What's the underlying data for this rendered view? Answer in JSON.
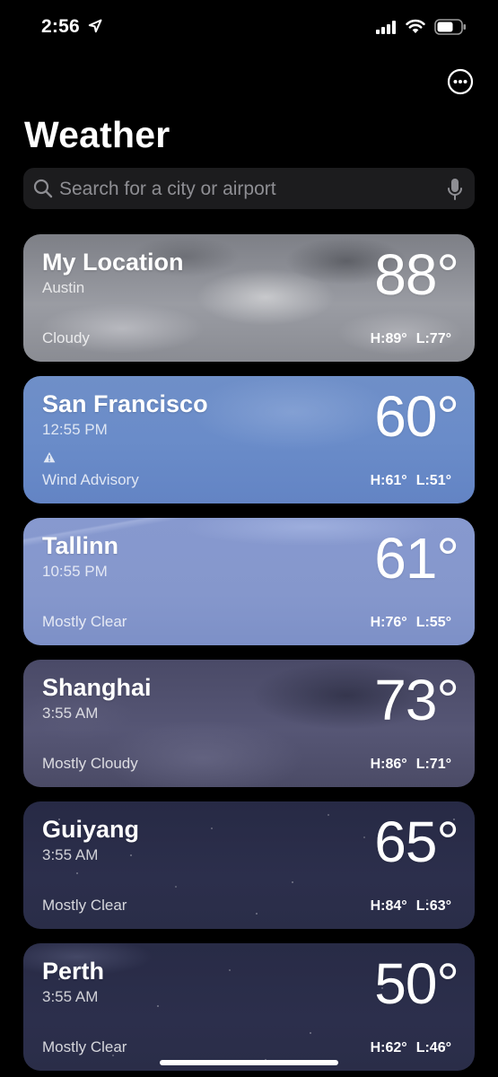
{
  "status_bar": {
    "time": "2:56"
  },
  "header": {
    "title": "Weather",
    "more_icon": "ellipsis-circle-icon"
  },
  "search": {
    "placeholder": "Search for a city or airport"
  },
  "cities": [
    {
      "name": "My Location",
      "subtitle": "Austin",
      "temp": "88°",
      "condition": "Cloudy",
      "high": "H:89°",
      "low": "L:77°"
    },
    {
      "name": "San Francisco",
      "subtitle": "12:55 PM",
      "temp": "60°",
      "condition": "Wind Advisory",
      "alert_icon": "warning-triangle-icon",
      "high": "H:61°",
      "low": "L:51°"
    },
    {
      "name": "Tallinn",
      "subtitle": "10:55 PM",
      "temp": "61°",
      "condition": "Mostly Clear",
      "high": "H:76°",
      "low": "L:55°"
    },
    {
      "name": "Shanghai",
      "subtitle": "3:55 AM",
      "temp": "73°",
      "condition": "Mostly Cloudy",
      "high": "H:86°",
      "low": "L:71°"
    },
    {
      "name": "Guiyang",
      "subtitle": "3:55 AM",
      "temp": "65°",
      "condition": "Mostly Clear",
      "high": "H:84°",
      "low": "L:63°"
    },
    {
      "name": "Perth",
      "subtitle": "3:55 AM",
      "temp": "50°",
      "condition": "Mostly Clear",
      "high": "H:62°",
      "low": "L:46°"
    }
  ]
}
